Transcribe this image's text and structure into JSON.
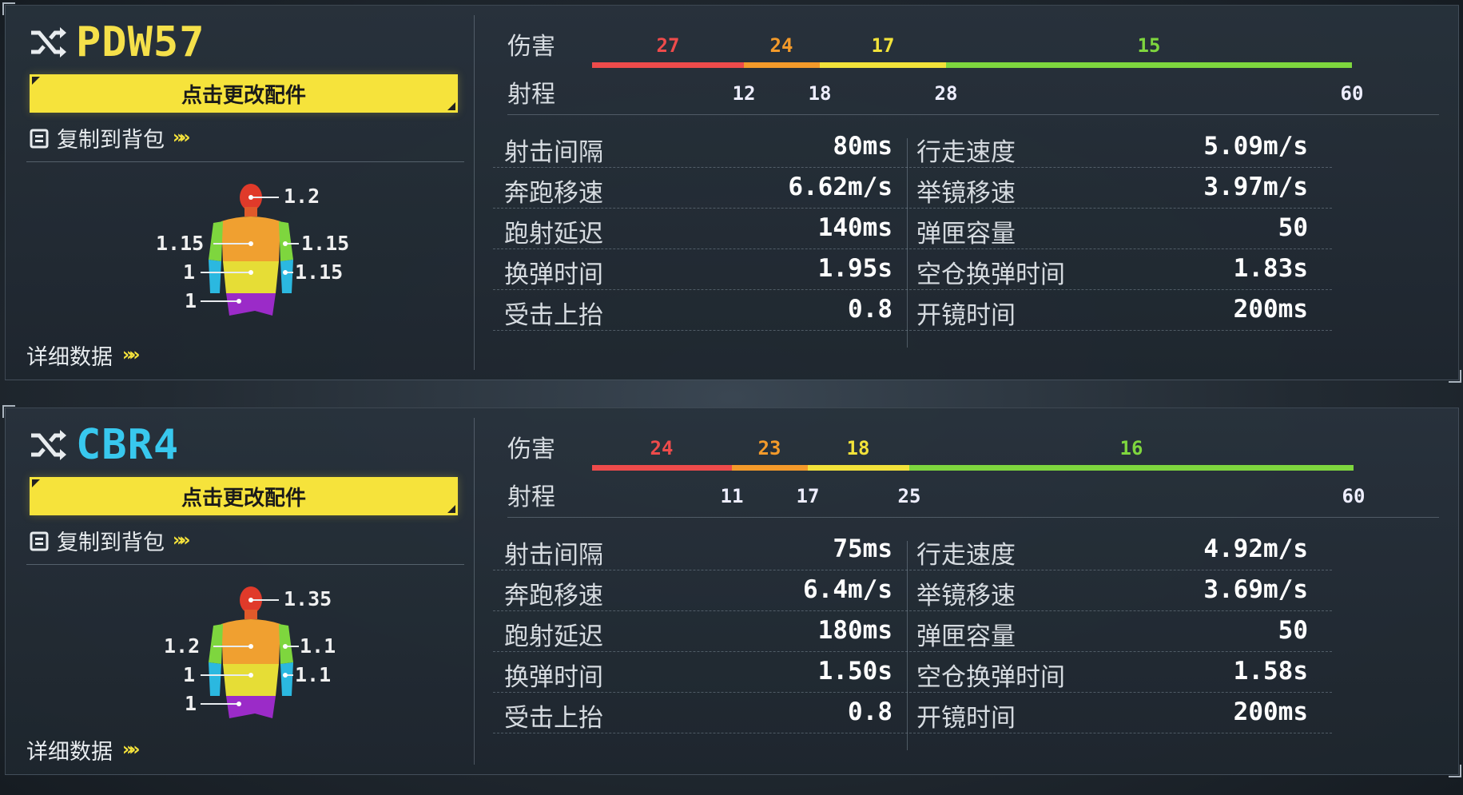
{
  "colors": {
    "segment_red": "#ee4b4b",
    "segment_orange": "#f39a2a",
    "segment_yellow": "#f2e23a",
    "segment_green": "#7ed63e",
    "button_yellow": "#f6e33b",
    "pdw_name": "#f5e04a",
    "cbr_name": "#38c8ee"
  },
  "labels": {
    "damage": "伤害",
    "range": "射程",
    "change_attachments": "点击更改配件",
    "copy_to_backpack": "复制到背包",
    "detailed_data": "详细数据"
  },
  "weapons": [
    {
      "name": "PDW57",
      "damage": [
        "27",
        "24",
        "17",
        "15"
      ],
      "range_ticks": [
        "12",
        "18",
        "28",
        "60"
      ],
      "multipliers": {
        "head": "1.2",
        "chest_left": "1.15",
        "chest_right": "1.15",
        "stomach_left": "1",
        "arm_right": "1.15",
        "legs": "1"
      },
      "stats_left": [
        {
          "label": "射击间隔",
          "value": "80ms"
        },
        {
          "label": "奔跑移速",
          "value": "6.62m/s"
        },
        {
          "label": "跑射延迟",
          "value": "140ms"
        },
        {
          "label": "换弹时间",
          "value": "1.95s"
        },
        {
          "label": "受击上抬",
          "value": "0.8"
        }
      ],
      "stats_right": [
        {
          "label": "行走速度",
          "value": "5.09m/s"
        },
        {
          "label": "举镜移速",
          "value": "3.97m/s"
        },
        {
          "label": "弹匣容量",
          "value": "50"
        },
        {
          "label": "空仓换弹时间",
          "value": "1.83s"
        },
        {
          "label": "开镜时间",
          "value": "200ms"
        }
      ]
    },
    {
      "name": "CBR4",
      "damage": [
        "24",
        "23",
        "18",
        "16"
      ],
      "range_ticks": [
        "11",
        "17",
        "25",
        "60"
      ],
      "multipliers": {
        "head": "1.35",
        "chest_left": "1.2",
        "chest_right": "1.1",
        "stomach_left": "1",
        "arm_right": "1.1",
        "legs": "1"
      },
      "stats_left": [
        {
          "label": "射击间隔",
          "value": "75ms"
        },
        {
          "label": "奔跑移速",
          "value": "6.4m/s"
        },
        {
          "label": "跑射延迟",
          "value": "180ms"
        },
        {
          "label": "换弹时间",
          "value": "1.50s"
        },
        {
          "label": "受击上抬",
          "value": "0.8"
        }
      ],
      "stats_right": [
        {
          "label": "行走速度",
          "value": "4.92m/s"
        },
        {
          "label": "举镜移速",
          "value": "3.69m/s"
        },
        {
          "label": "弹匣容量",
          "value": "50"
        },
        {
          "label": "空仓换弹时间",
          "value": "1.58s"
        },
        {
          "label": "开镜时间",
          "value": "200ms"
        }
      ]
    }
  ]
}
